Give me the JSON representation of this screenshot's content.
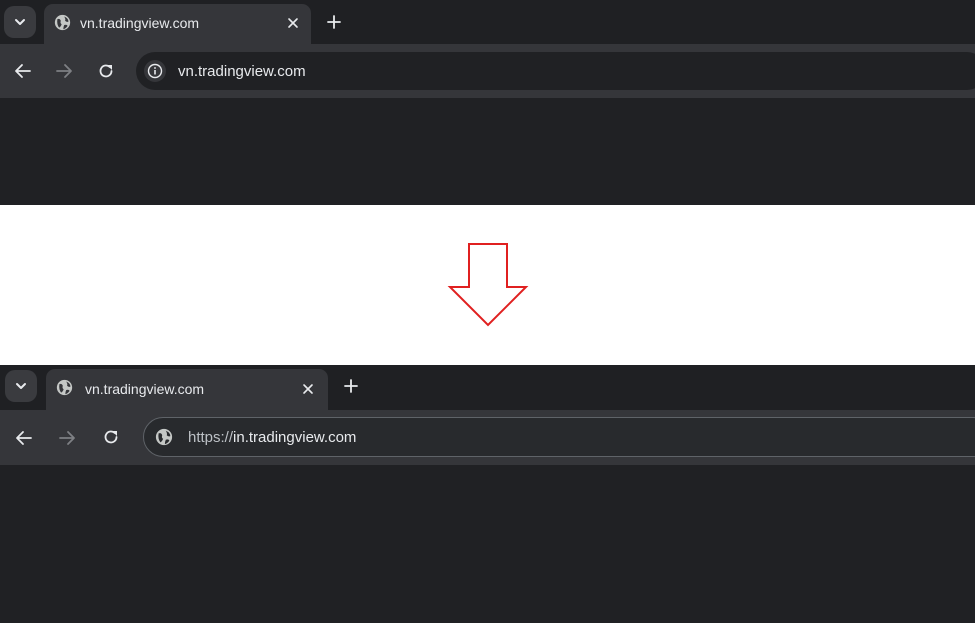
{
  "before": {
    "tab_title": "vn.tradingview.com",
    "address": "vn.tradingview.com",
    "omnibox_icon": "info-icon",
    "favicon": "globe-icon"
  },
  "after": {
    "tab_title": "vn.tradingview.com",
    "address_scheme": "https://",
    "address_host": "in.tradingview.com",
    "omnibox_icon": "globe-icon",
    "favicon": "globe-icon"
  },
  "transition": {
    "icon": "down-arrow-icon",
    "color": "#e02020"
  },
  "colors": {
    "tabstrip": "#1f2023",
    "toolbar": "#35363a",
    "content": "#202124",
    "text": "#e8eaed"
  }
}
